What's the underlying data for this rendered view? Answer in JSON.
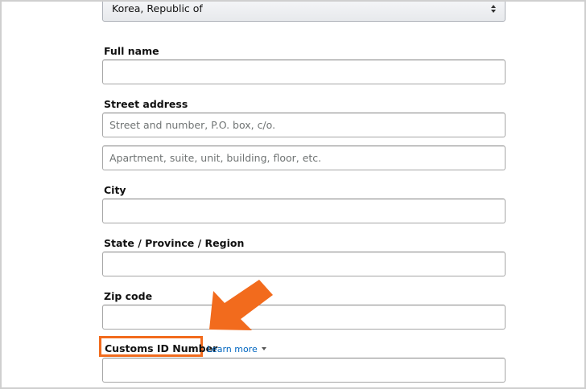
{
  "form": {
    "country": {
      "selected": "Korea, Republic of"
    },
    "full_name": {
      "label": "Full name",
      "value": "",
      "placeholder": ""
    },
    "street_address": {
      "label": "Street address",
      "line1_placeholder": "Street and number, P.O. box, c/o.",
      "line2_placeholder": "Apartment, suite, unit, building, floor, etc."
    },
    "city": {
      "label": "City",
      "value": ""
    },
    "state": {
      "label": "State / Province / Region",
      "value": ""
    },
    "zip": {
      "label": "Zip code",
      "value": ""
    },
    "customs_id": {
      "label": "Customs ID Number",
      "learn_more": "Learn more",
      "value": ""
    }
  },
  "annotation": {
    "arrow_color": "#f26b1d",
    "highlight_color": "#f26b1d"
  },
  "icons": {
    "select_arrows": "updown-arrows-icon",
    "learn_more_caret": "caret-down-icon",
    "callout_arrow": "arrow-down-left-icon"
  }
}
